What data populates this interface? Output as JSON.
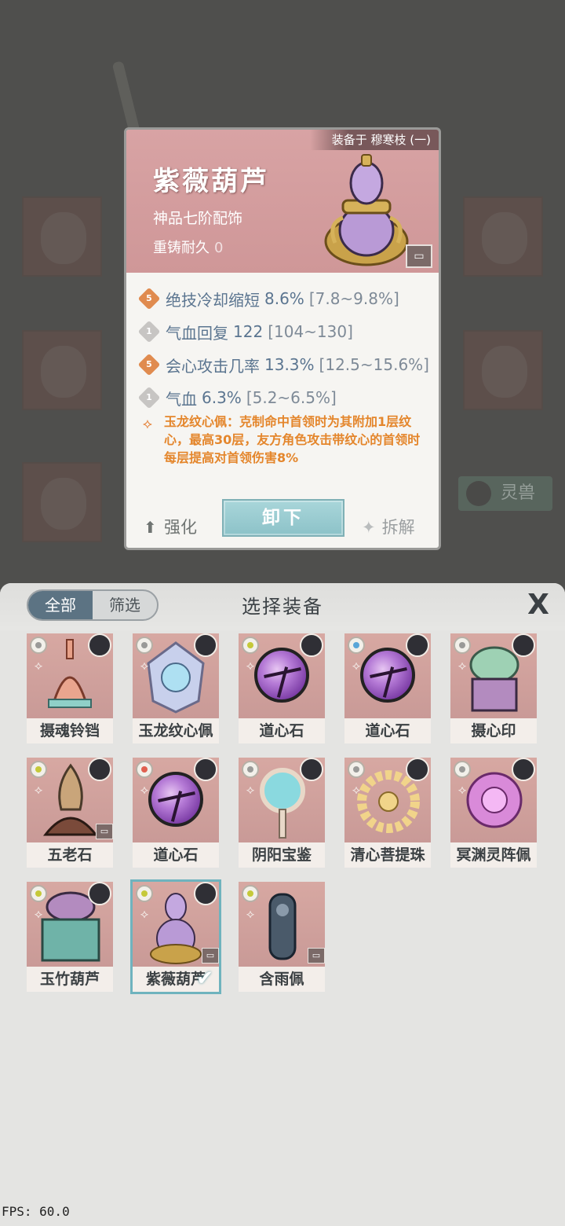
{
  "detail": {
    "equipped_to": "装备于 穆寒枝 (一)",
    "name": "紫薇葫芦",
    "grade": "神品七阶配饰",
    "durability_label": "重铸耐久",
    "durability_value": "0",
    "stats": [
      {
        "level": "5",
        "tier": "orange",
        "name": "绝技冷却缩短",
        "value": "8.6%",
        "range": "[7.8~9.8%]"
      },
      {
        "level": "1",
        "tier": "gray",
        "name": "气血回复",
        "value": "122",
        "range": "[104~130]"
      },
      {
        "level": "5",
        "tier": "orange",
        "name": "会心攻击几率",
        "value": "13.3%",
        "range": "[12.5~15.6%]"
      },
      {
        "level": "1",
        "tier": "gray",
        "name": "气血",
        "value": "6.3%",
        "range": "[5.2~6.5%]"
      }
    ],
    "passive": "玉龙纹心佩：克制命中首领时为其附加1层纹心，最高30层，友方角色攻击带纹心的首领时每层提高对首领伤害8%",
    "strengthen_label": "强化",
    "unequip_label": "卸下",
    "dismantle_label": "拆解"
  },
  "background": {
    "beast_label": "灵兽"
  },
  "panel": {
    "title": "选择装备",
    "tab_all": "全部",
    "tab_filter": "筛选",
    "close_glyph": "X"
  },
  "items": [
    {
      "name": "摄魂铃铛",
      "art": "bell",
      "elem_color": "#9a9a98"
    },
    {
      "name": "玉龙纹心佩",
      "art": "jade",
      "elem_color": "#9a9a98"
    },
    {
      "name": "道心石",
      "art": "orb",
      "elem_color": "#c5c939"
    },
    {
      "name": "道心石",
      "art": "orb",
      "elem_color": "#5aa6d8"
    },
    {
      "name": "摄心印",
      "art": "seal",
      "elem_color": "#9a9a98"
    },
    {
      "name": "五老石",
      "art": "stone",
      "elem_color": "#c5c939"
    },
    {
      "name": "道心石",
      "art": "orb",
      "elem_color": "#e06050"
    },
    {
      "name": "阴阳宝鉴",
      "art": "mirror",
      "elem_color": "#9a9a98"
    },
    {
      "name": "清心菩提珠",
      "art": "beads",
      "elem_color": "#9a9a98"
    },
    {
      "name": "冥渊灵阵佩",
      "art": "spirit",
      "elem_color": "#9a9a98"
    },
    {
      "name": "玉竹葫芦",
      "art": "box",
      "elem_color": "#c5c939"
    },
    {
      "name": "紫薇葫芦",
      "art": "gourd",
      "elem_color": "#c5c939"
    },
    {
      "name": "含雨佩",
      "art": "pendant",
      "elem_color": "#c5c939"
    }
  ],
  "fps": "FPS: 60.0"
}
